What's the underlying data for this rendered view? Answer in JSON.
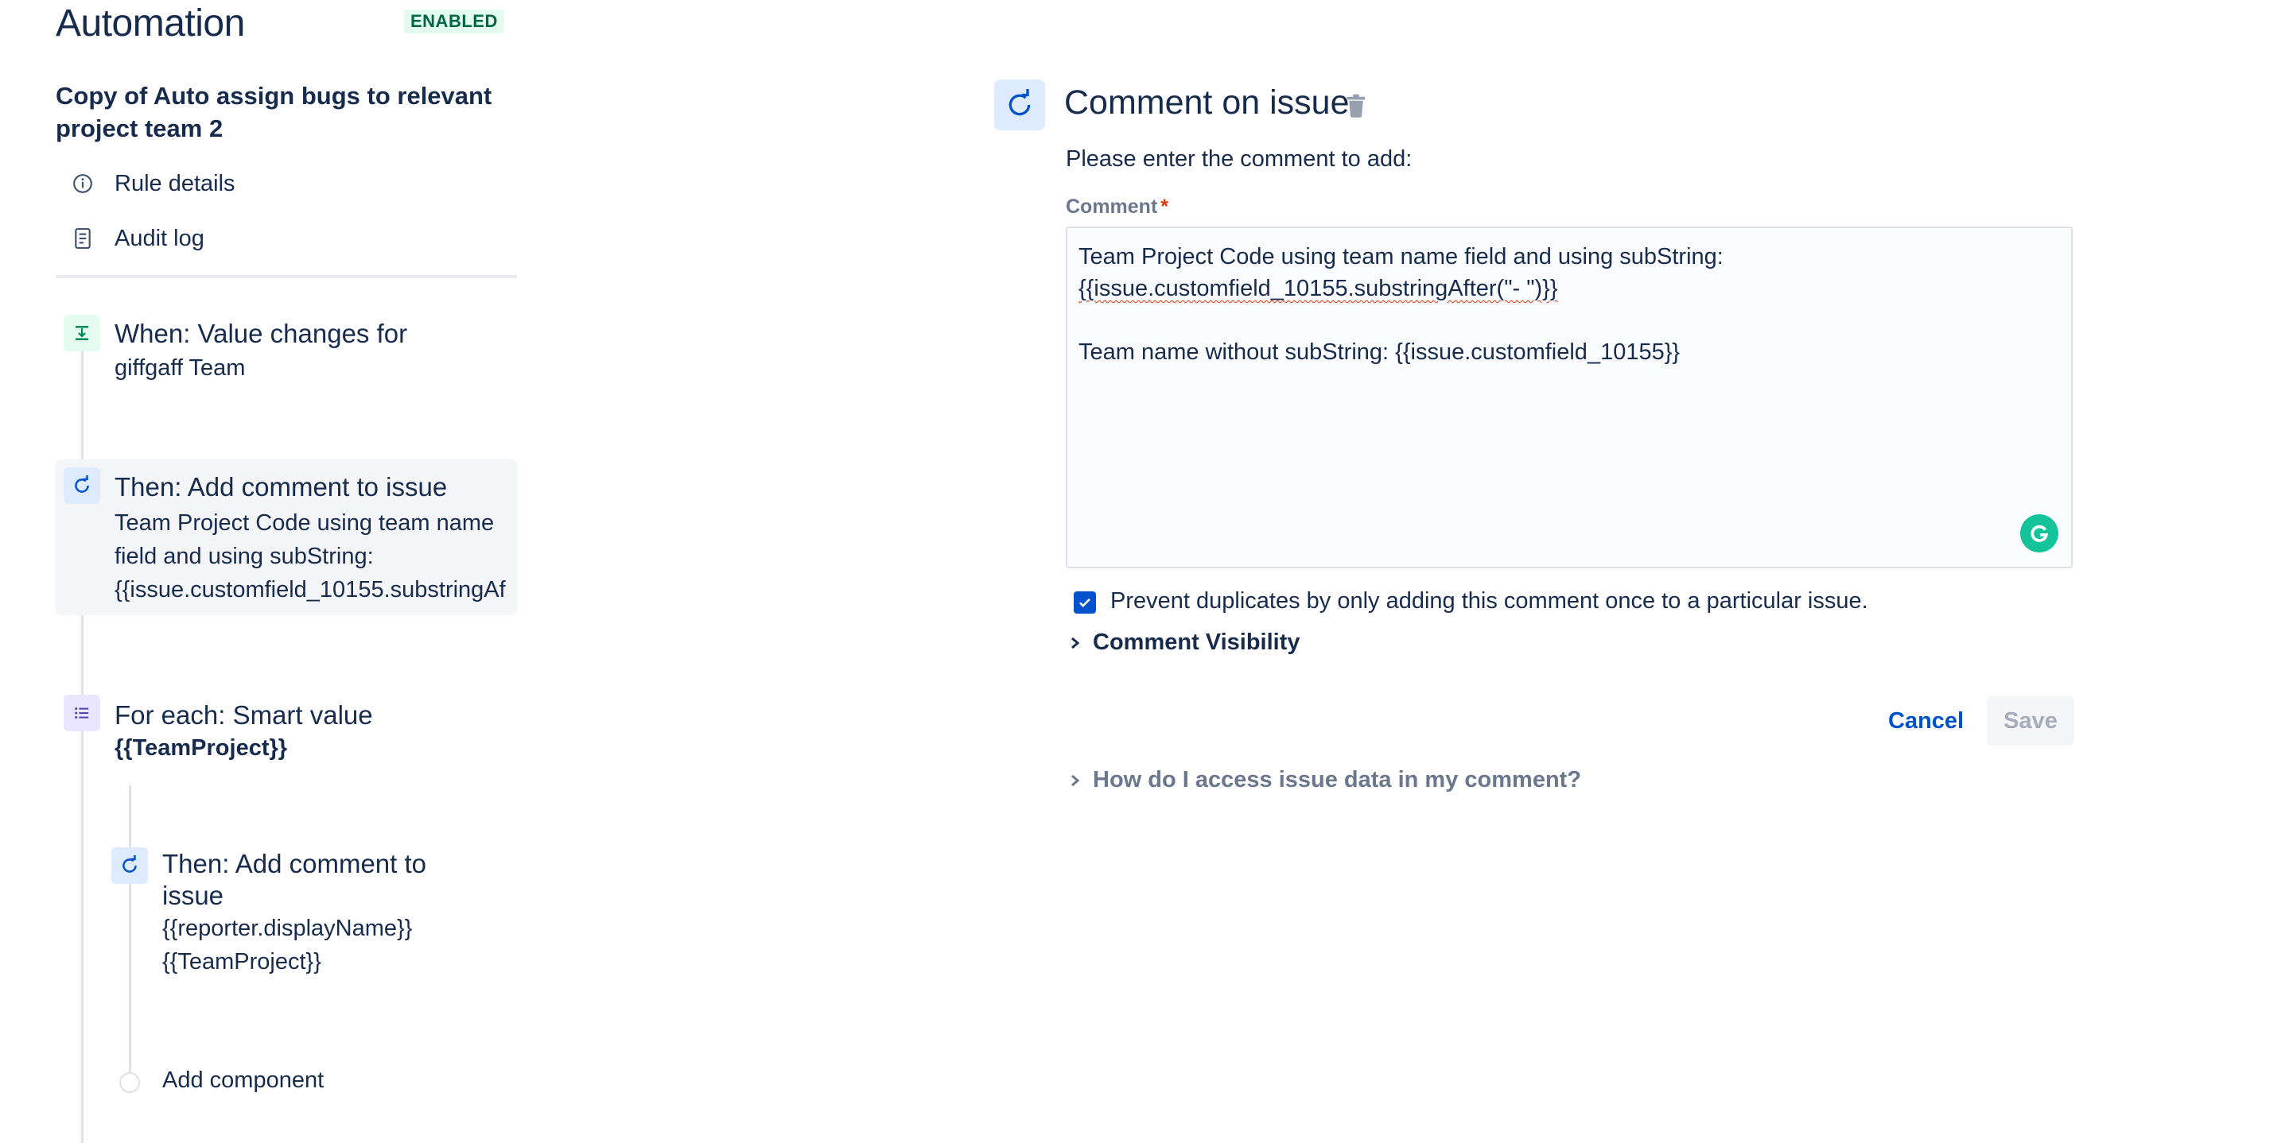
{
  "header": {
    "title": "Automation",
    "status_badge": "ENABLED"
  },
  "rule": {
    "title": "Copy of Auto assign bugs to relevant project team 2",
    "nav": [
      {
        "label": "Rule details",
        "icon": "info-icon"
      },
      {
        "label": "Audit log",
        "icon": "document-icon"
      }
    ]
  },
  "flow": {
    "trigger": {
      "title": "When: Value changes for",
      "subtitle": "giffgaff Team",
      "icon": "trigger-icon"
    },
    "action1": {
      "title": "Then: Add comment to issue",
      "lines": [
        "Team Project Code using team name",
        "field and using subString:",
        "{{issue.customfield_10155.substringAf"
      ],
      "icon": "comment-refresh-icon"
    },
    "branch": {
      "title": "For each: Smart value",
      "subtitle": "{{TeamProject}}",
      "icon": "list-icon"
    },
    "action2": {
      "title_lines": [
        "Then: Add comment to",
        "issue"
      ],
      "lines": [
        "{{reporter.displayName}}",
        "{{TeamProject}}"
      ],
      "icon": "comment-refresh-icon"
    },
    "add_component": "Add component"
  },
  "panel": {
    "title": "Comment on issue",
    "prompt": "Please enter the comment to add:",
    "comment_label": "Comment",
    "required_marker": "*",
    "comment_lines": [
      "Team Project Code using team name field and using subString:",
      "{{issue.customfield_10155.substringAfter(\"- \")}}",
      "",
      "Team name without subString: {{issue.customfield_10155}}"
    ],
    "prevent_duplicates": {
      "checked": true,
      "label": "Prevent duplicates by only adding this comment once to a particular issue."
    },
    "visibility_label": "Comment Visibility",
    "cancel_label": "Cancel",
    "save_label": "Save",
    "help_label": "How do I access issue data in my comment?"
  },
  "colors": {
    "accent": "#0052cc",
    "badge_bg": "#e3fcef",
    "badge_text": "#006644",
    "grammarly": "#15c39a"
  }
}
